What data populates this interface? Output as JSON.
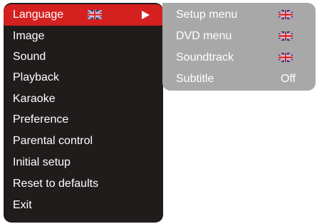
{
  "main_menu": {
    "items": [
      {
        "label": "Language",
        "icon": "uk-flag-icon",
        "submenu_arrow": true
      },
      {
        "label": "Image"
      },
      {
        "label": "Sound"
      },
      {
        "label": "Playback"
      },
      {
        "label": "Karaoke"
      },
      {
        "label": "Preference"
      },
      {
        "label": "Parental control"
      },
      {
        "label": "Initial setup"
      },
      {
        "label": "Reset to defaults"
      },
      {
        "label": "Exit"
      }
    ],
    "selected_index": 0
  },
  "language_submenu": {
    "items": [
      {
        "label": "Setup menu",
        "value_icon": "uk-flag-icon"
      },
      {
        "label": "DVD menu",
        "value_icon": "uk-flag-icon"
      },
      {
        "label": "Soundtrack",
        "value_icon": "uk-flag-icon"
      },
      {
        "label": "Subtitle",
        "value": "Off"
      }
    ]
  },
  "colors": {
    "menu_background": "#201c1c",
    "selected_background": "#d52020",
    "submenu_background": "#a8a8a8",
    "text": "#ffffff"
  }
}
